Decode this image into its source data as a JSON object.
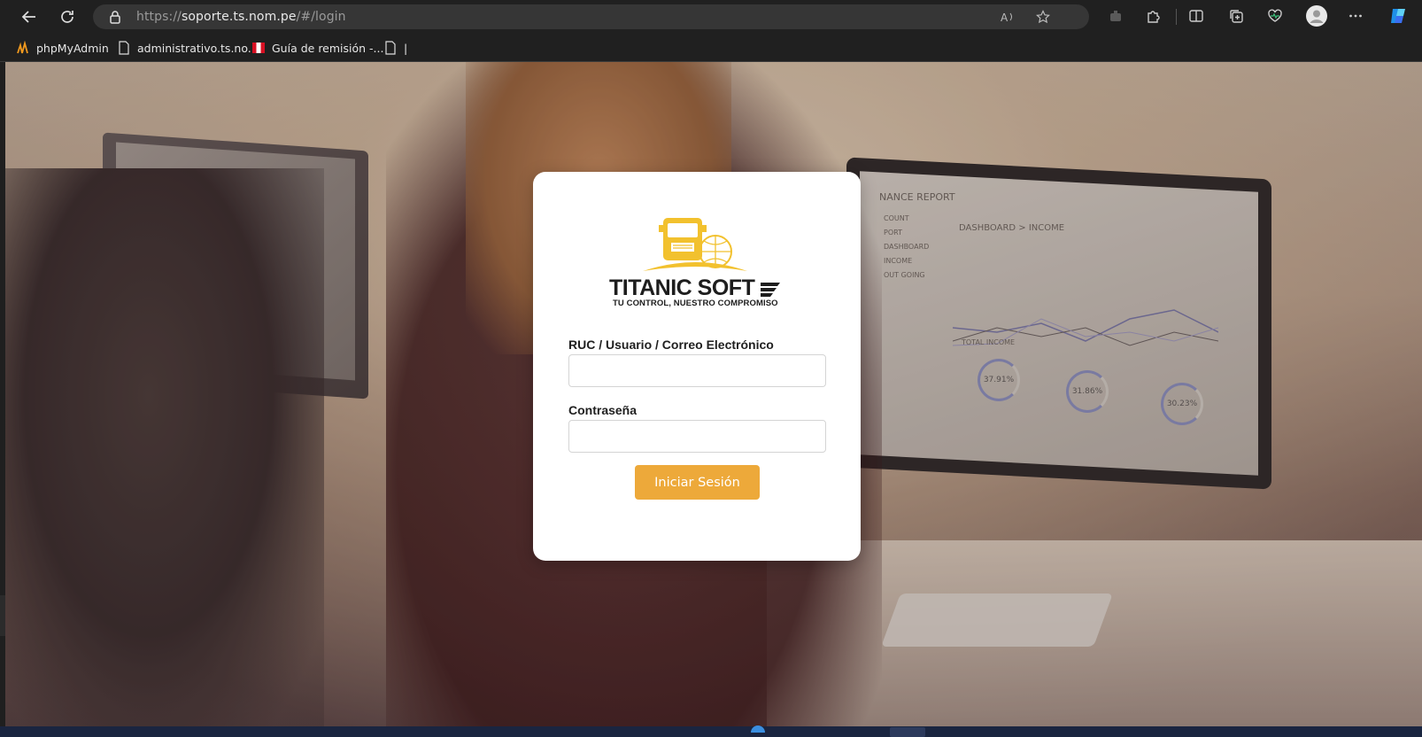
{
  "browser": {
    "url_scheme": "https://",
    "url_host": "soporte.ts.nom.pe",
    "url_path": "/#/login",
    "bookmarks": [
      {
        "label": "phpMyAdmin",
        "icon": "phpmyadmin-icon"
      },
      {
        "label": "administrativo.ts.no...",
        "icon": "page-icon"
      },
      {
        "label": "Guía de remisión -...",
        "icon": "peru-flag-icon"
      },
      {
        "label": "|",
        "icon": "page-icon"
      }
    ]
  },
  "login": {
    "logo_title": "TITANIC SOFT",
    "logo_tagline": "TU CONTROL, NUESTRO COMPROMISO",
    "user_label": "RUC / Usuario / Correo Electrónico",
    "user_value": "",
    "password_label": "Contraseña",
    "password_value": "",
    "submit_label": "Iniciar Sesión"
  },
  "background_dashboard": {
    "title": "NANCE REPORT",
    "subtitle": "DASHBOARD > INCOME",
    "menu": [
      "COUNT",
      "PORT",
      "DASHBOARD",
      "INCOME",
      "OUT GOING"
    ],
    "total_label": "TOTAL INCOME",
    "gauges": [
      "37.91%",
      "31.86%",
      "30.23%"
    ]
  },
  "colors": {
    "accent": "#eda93a",
    "logo_yellow": "#f2c12e",
    "browser_bg": "#202020"
  }
}
